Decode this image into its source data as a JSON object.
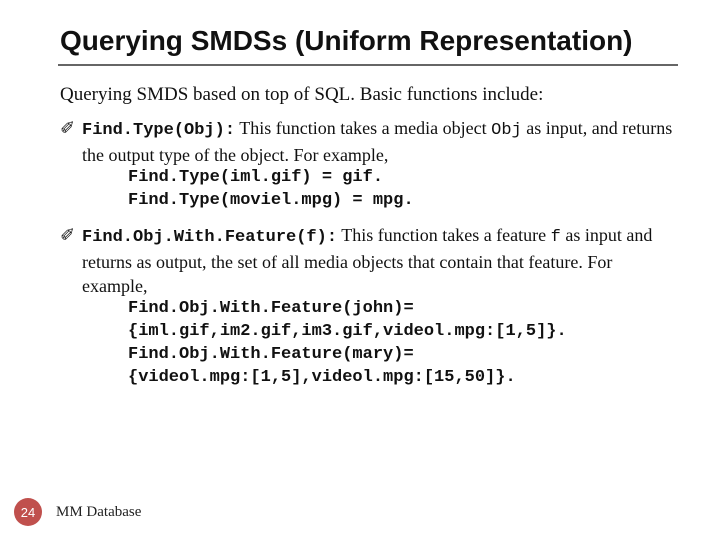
{
  "title": "Querying SMDSs (Uniform Representation)",
  "intro": "Querying SMDS based on top of SQL.  Basic functions include:",
  "bullet_glyph": "✐",
  "item1": {
    "func": "Find.Type(Obj):",
    "desc_a": " This function takes a media object ",
    "arg": "Obj",
    "desc_b": " as input, and returns the output type of the object. For example,",
    "ex1": "Find.Type(iml.gif) = gif.",
    "ex2": "Find.Type(moviel.mpg) = mpg."
  },
  "item2": {
    "func": "Find.Obj.With.Feature(f):",
    "desc_a": " This function takes a feature ",
    "arg": "f",
    "desc_b": " as input and returns as output, the set of all media objects that contain that feature. For example,",
    "ex1": "Find.Obj.With.Feature(john)=",
    "ex2": "{iml.gif,im2.gif,im3.gif,videol.mpg:[1,5]}.",
    "ex3": "Find.Obj.With.Feature(mary)=",
    "ex4": "{videol.mpg:[1,5],videol.mpg:[15,50]}."
  },
  "footer": {
    "page": "24",
    "label": "MM Database"
  }
}
